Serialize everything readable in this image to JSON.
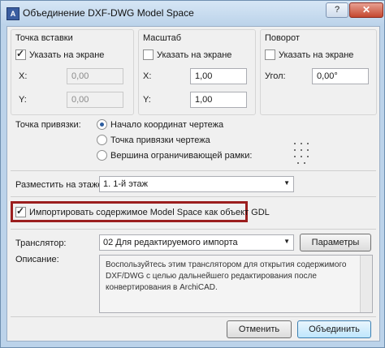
{
  "window": {
    "title": "Объединение DXF-DWG Model Space",
    "help": "?",
    "close": "✕"
  },
  "insertion_point": {
    "heading": "Точка вставки",
    "show_on_screen": "Указать на экране",
    "x_label": "X:",
    "x_value": "0,00",
    "y_label": "Y:",
    "y_value": "0,00"
  },
  "scale": {
    "heading": "Масштаб",
    "show_on_screen": "Указать на экране",
    "x_label": "X:",
    "x_value": "1,00",
    "y_label": "Y:",
    "y_value": "1,00"
  },
  "rotation": {
    "heading": "Поворот",
    "show_on_screen": "Указать на экране",
    "angle_label": "Угол:",
    "angle_value": "0,00°"
  },
  "anchor": {
    "label": "Точка привязки:",
    "options": [
      "Начало координат чертежа",
      "Точка привязки чертежа",
      "Вершина ограничивающей рамки:"
    ],
    "selected": 0
  },
  "place_on_floor": {
    "label": "Разместить на этаже:",
    "value": "1. 1-й этаж"
  },
  "import_gdl": {
    "label": "Импортировать содержимое Model Space как объект GDL",
    "checked": true
  },
  "translator": {
    "label": "Транслятор:",
    "value": "02 Для редактируемого импорта",
    "params_button": "Параметры"
  },
  "description": {
    "label": "Описание:",
    "text": "Воспользуйтесь этим транслятором для открытия содержимого DXF/DWG с целью дальнейшего редактирования после конвертирования в ArchiCAD."
  },
  "buttons": {
    "cancel": "Отменить",
    "merge": "Объединить"
  },
  "colors": {
    "highlight": "#9b1e1e",
    "title_bar": "#bcd3ea",
    "radio_dot": "#2d5d9f"
  }
}
